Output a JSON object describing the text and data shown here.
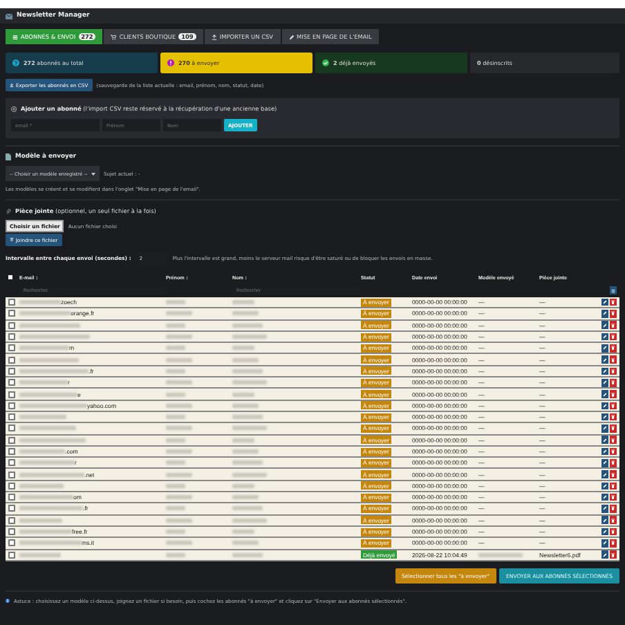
{
  "window": {
    "title": "Newsletter Manager"
  },
  "tabs": [
    {
      "label": "ABONNÉS & ENVOI",
      "badge": "272",
      "selected": true
    },
    {
      "label": "CLIENTS BOUTIQUE",
      "badge": "109",
      "selected": false
    },
    {
      "label": "IMPORTER UN CSV",
      "selected": false
    },
    {
      "label": "MISE EN PAGE DE L'EMAIL",
      "selected": false
    }
  ],
  "stats": [
    {
      "kind": "info",
      "color": "#173c4c",
      "value": "272",
      "label": "abonnés au total"
    },
    {
      "kind": "alert",
      "color": "#e3c000",
      "value": "270",
      "label": "à envoyer"
    },
    {
      "kind": "check",
      "color": "#17391f",
      "value": "2",
      "label": "déjà envoyés"
    },
    {
      "kind": "plain",
      "color": "#26282c",
      "value": "0",
      "label": "désinscrits"
    }
  ],
  "export": {
    "button": "Exporter les abonnés en CSV",
    "note": "(sauvegarde de la liste actuelle : email, prénom, nom, statut, date)"
  },
  "add_subscriber": {
    "title": "Ajouter un abonné",
    "note": "(l'import CSV reste réservé à la récupération d'une ancienne base)",
    "fields": [
      {
        "placeholder": "email *"
      },
      {
        "placeholder": "Prénom"
      },
      {
        "placeholder": "Nom"
      }
    ],
    "button": "AJOUTER"
  },
  "template": {
    "title": "Modèle à envoyer",
    "select": "-- Choisir un modèle enregistré --",
    "subject": "Sujet actuel : -",
    "note": "Les modèles se créent et se modifient dans l'onglet \"Mise en page de l'email\"."
  },
  "attachment": {
    "title": "Pièce jointe",
    "note": "(optionnel, un seul fichier à la fois)",
    "file_button": "Choisir un fichier",
    "file_status": "Aucun fichier choisi",
    "button": "Joindre ce fichier"
  },
  "interval": {
    "label": "Intervalle entre chaque envoi (secondes) :",
    "value": "2",
    "note": "Plus l'intervalle est grand, moins le serveur mail risque d'être saturé ou de bloquer les envois en masse."
  },
  "table": {
    "select_all": {
      "checked": false
    },
    "columns": [
      "E-mail ↕",
      "Prénom ↕",
      "Nom ↕",
      "Statut",
      "Date envoi",
      "Modèle envoyé",
      "Pièce jointe"
    ],
    "filters": [
      {
        "placeholder": "Rechercher"
      },
      {
        "placeholder": "Rechercher"
      }
    ],
    "rows": [
      {
        "checked": false,
        "email": "zoech",
        "status": "À envoyer",
        "kind": "pending",
        "date": "0000-00-00 00:00:00",
        "model": "—",
        "attachment": "—"
      },
      {
        "checked": false,
        "email": "orange.fr",
        "status": "À envoyer",
        "kind": "pending",
        "date": "0000-00-00 00:00:00",
        "model": "—",
        "attachment": "—"
      },
      {
        "checked": false,
        "status": "À envoyer",
        "kind": "pending",
        "date": "0000-00-00 00:00:00",
        "model": "—",
        "attachment": "—"
      },
      {
        "checked": false,
        "status": "À envoyer",
        "kind": "pending",
        "date": "0000-00-00 00:00:00",
        "model": "—",
        "attachment": "—"
      },
      {
        "checked": false,
        "email": "m",
        "status": "À envoyer",
        "kind": "pending",
        "date": "0000-00-00 00:00:00",
        "model": "—",
        "attachment": "—"
      },
      {
        "checked": false,
        "status": "À envoyer",
        "kind": "pending",
        "date": "0000-00-00 00:00:00",
        "model": "—",
        "attachment": "—"
      },
      {
        "checked": false,
        "email": ".fr",
        "status": "À envoyer",
        "kind": "pending",
        "date": "0000-00-00 00:00:00",
        "model": "—",
        "attachment": "—"
      },
      {
        "checked": false,
        "email": "r",
        "status": "À envoyer",
        "kind": "pending",
        "date": "0000-00-00 00:00:00",
        "model": "—",
        "attachment": "—"
      },
      {
        "checked": false,
        "email": "e",
        "status": "À envoyer",
        "kind": "pending",
        "date": "0000-00-00 00:00:00",
        "model": "—",
        "attachment": "—"
      },
      {
        "checked": false,
        "email": "yahoo.com",
        "status": "À envoyer",
        "kind": "pending",
        "date": "0000-00-00 00:00:00",
        "model": "—",
        "attachment": "—"
      },
      {
        "checked": false,
        "status": "À envoyer",
        "kind": "pending",
        "date": "0000-00-00 00:00:00",
        "model": "—",
        "attachment": "—"
      },
      {
        "checked": false,
        "status": "À envoyer",
        "kind": "pending",
        "date": "0000-00-00 00:00:00",
        "model": "—",
        "attachment": "—"
      },
      {
        "checked": false,
        "status": "À envoyer",
        "kind": "pending",
        "date": "0000-00-00 00:00:00",
        "model": "—",
        "attachment": "—"
      },
      {
        "checked": false,
        "email": ".com",
        "status": "À envoyer",
        "kind": "pending",
        "date": "0000-00-00 00:00:00",
        "model": "—",
        "attachment": "—"
      },
      {
        "checked": false,
        "email": "r",
        "status": "À envoyer",
        "kind": "pending",
        "date": "0000-00-00 00:00:00",
        "model": "—",
        "attachment": "—"
      },
      {
        "checked": false,
        "email": ".net",
        "status": "À envoyer",
        "kind": "pending",
        "date": "0000-00-00 00:00:00",
        "model": "—",
        "attachment": "—"
      },
      {
        "checked": false,
        "status": "À envoyer",
        "kind": "pending",
        "date": "0000-00-00 00:00:00",
        "model": "—",
        "attachment": "—"
      },
      {
        "checked": false,
        "email": "om",
        "status": "À envoyer",
        "kind": "pending",
        "date": "0000-00-00 00:00:00",
        "model": "—",
        "attachment": "—"
      },
      {
        "checked": false,
        "email": ".fr",
        "status": "À envoyer",
        "kind": "pending",
        "date": "0000-00-00 00:00:00",
        "model": "—",
        "attachment": "—"
      },
      {
        "checked": false,
        "status": "À envoyer",
        "kind": "pending",
        "date": "0000-00-00 00:00:00",
        "model": "—",
        "attachment": "—"
      },
      {
        "checked": false,
        "email": "free.fr",
        "status": "À envoyer",
        "kind": "pending",
        "date": "0000-00-00 00:00:00",
        "model": "—",
        "attachment": "—"
      },
      {
        "checked": false,
        "email": "ms.it",
        "status": "À envoyer",
        "kind": "pending",
        "date": "0000-00-00 00:00:00",
        "model": "—",
        "attachment": "—"
      },
      {
        "checked": false,
        "status": "Déjà envoyé",
        "kind": "sent",
        "date": "2026-08-22 10:04:49",
        "attachment": "Newsletter6.pdf"
      }
    ]
  },
  "actions": {
    "select_pending": "Sélectionner tous les \"à envoyer\"",
    "send": "ENVOYER AUX ABONNÉS SÉLECTIONNÉS"
  },
  "tip": "Astuce : choisissez un modèle ci-dessus, joignez un fichier si besoin, puis cochez les abonnés \"à envoyer\" et cliquez sur \"Envoyer aux abonnés sélectionnés\"."
}
